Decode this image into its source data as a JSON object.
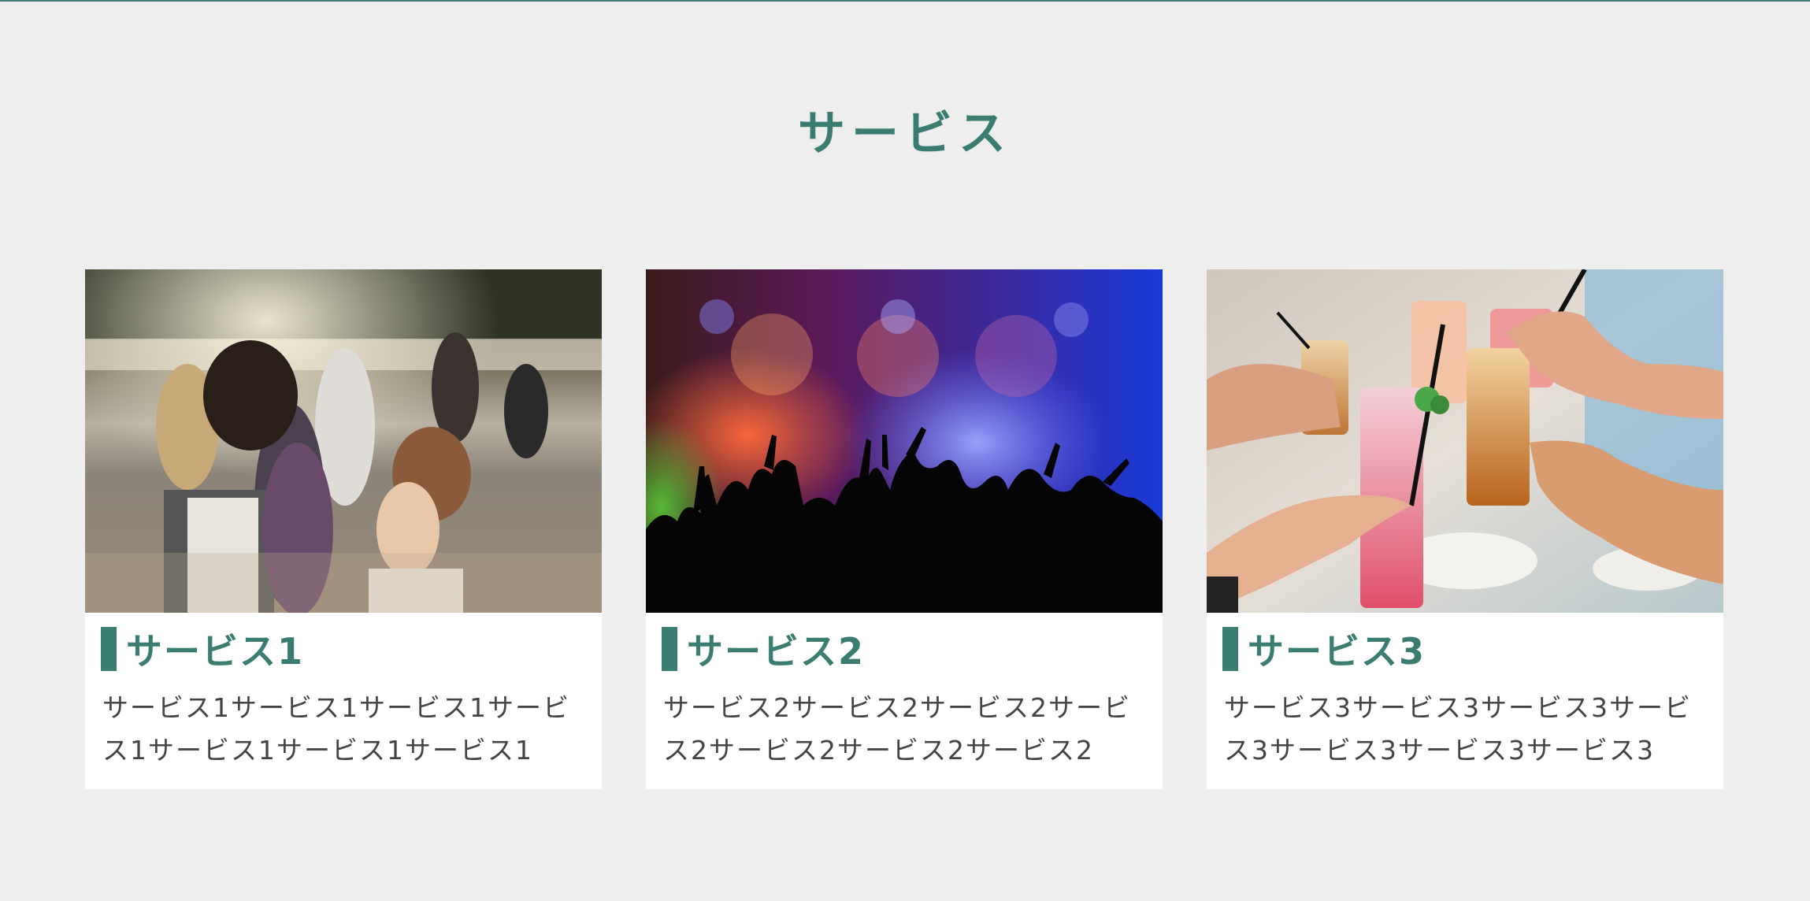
{
  "section": {
    "title": "サービス"
  },
  "colors": {
    "accent": "#3a7d70",
    "background": "#eeeeee",
    "card": "#ffffff",
    "text": "#444444"
  },
  "services": [
    {
      "title": "サービス1",
      "description": "サービス1サービス1サービス1サービス1サービス1サービス1サービス1",
      "image": "photo-crowd-outdoor-lake"
    },
    {
      "title": "サービス2",
      "description": "サービス2サービス2サービス2サービス2サービス2サービス2サービス2",
      "image": "photo-concert-silhouette-lights"
    },
    {
      "title": "サービス3",
      "description": "サービス3サービス3サービス3サービス3サービス3サービス3サービス3",
      "image": "photo-cocktail-toast"
    }
  ]
}
